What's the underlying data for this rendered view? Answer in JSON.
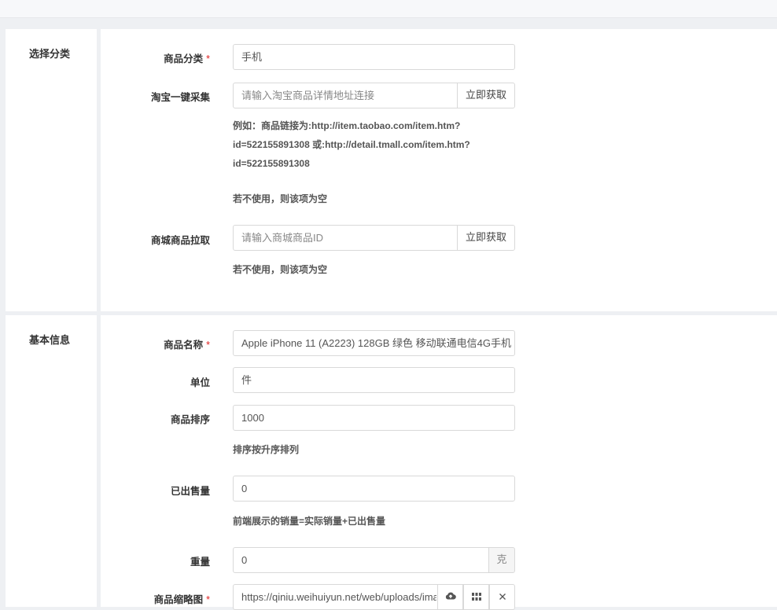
{
  "sections": {
    "category": {
      "title": "选择分类",
      "category_label": "商品分类",
      "category_value": "手机",
      "taobao_label": "淘宝一键采集",
      "taobao_placeholder": "请输入淘宝商品详情地址连接",
      "taobao_button": "立即获取",
      "taobao_help_1": "例如：商品链接为:http://item.taobao.com/item.htm?",
      "taobao_help_2": "id=522155891308 或:http://detail.tmall.com/item.htm?",
      "taobao_help_3": "id=522155891308",
      "taobao_help_empty": "若不使用，则该项为空",
      "mall_label": "商城商品拉取",
      "mall_placeholder": "请输入商城商品ID",
      "mall_button": "立即获取",
      "mall_help": "若不使用，则该项为空"
    },
    "basic": {
      "title": "基本信息",
      "name_label": "商品名称",
      "name_value": "Apple iPhone 11 (A2223) 128GB 绿色 移动联通电信4G手机",
      "unit_label": "单位",
      "unit_value": "件",
      "sort_label": "商品排序",
      "sort_value": "1000",
      "sort_help": "排序按升序排列",
      "sold_label": "已出售量",
      "sold_value": "0",
      "sold_help": "前端展示的销量=实际销量+已出售量",
      "weight_label": "重量",
      "weight_value": "0",
      "weight_unit": "克",
      "thumb_label": "商品缩略图",
      "thumb_value": "https://qiniu.weihuiyun.net/web/uploads/images/"
    }
  },
  "required_mark": "*",
  "icons": [
    "cloud-upload-icon",
    "grid-icon",
    "close-icon"
  ]
}
